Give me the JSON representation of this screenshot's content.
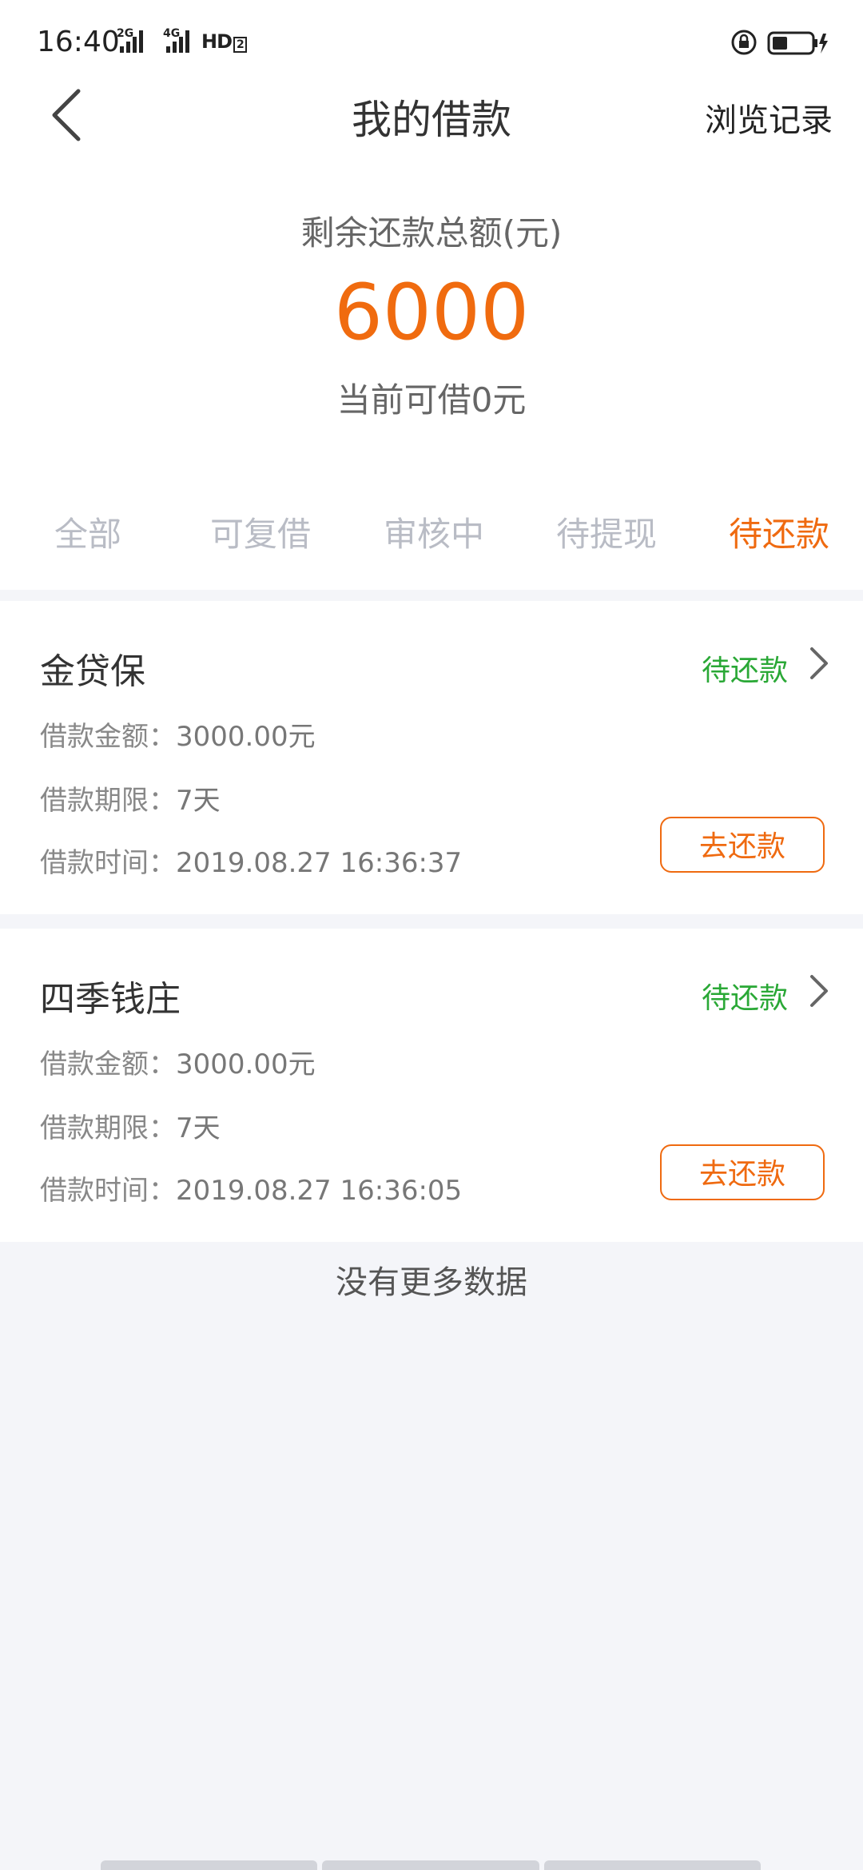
{
  "status_bar": {
    "time": "16:40",
    "net1": "2G",
    "net2": "4G",
    "hd": "HD",
    "hd_num": "2"
  },
  "nav": {
    "title": "我的借款",
    "history": "浏览记录"
  },
  "summary": {
    "label": "剩余还款总额(元)",
    "amount": "6000",
    "available": "当前可借0元"
  },
  "tabs": [
    "全部",
    "可复借",
    "审核中",
    "待提现",
    "待还款"
  ],
  "active_tab": "待还款",
  "labels": {
    "amount": "借款金额：",
    "term": "借款期限：",
    "time": "借款时间："
  },
  "loans": [
    {
      "name": "金贷保",
      "status": "待还款",
      "amount": "3000.00元",
      "term": "7天",
      "time": "2019.08.27 16:36:37",
      "action": "去还款"
    },
    {
      "name": "四季钱庄",
      "status": "待还款",
      "amount": "3000.00元",
      "term": "7天",
      "time": "2019.08.27 16:36:05",
      "action": "去还款"
    }
  ],
  "footer": {
    "no_more": "没有更多数据"
  },
  "colors": {
    "accent": "#ef6a10",
    "status_green": "#2aa836",
    "background": "#f4f5f9"
  }
}
